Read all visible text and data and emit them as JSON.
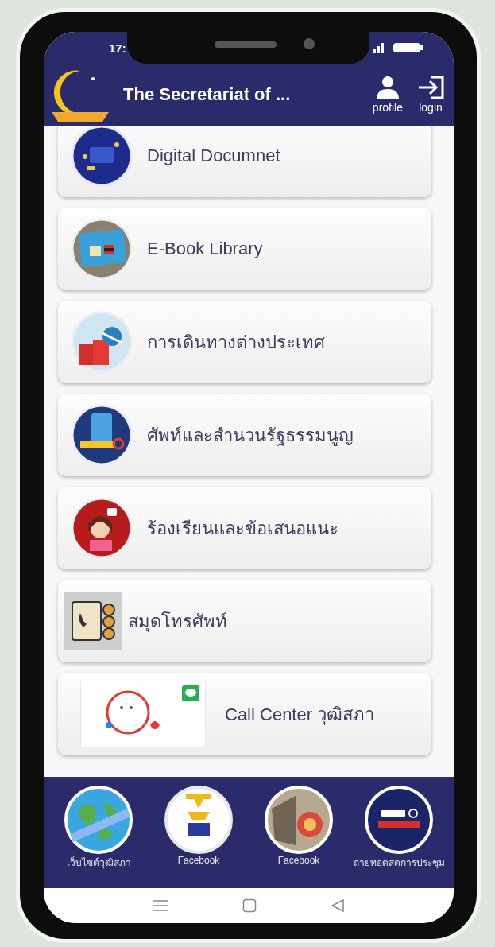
{
  "status_bar": {
    "time": "17:"
  },
  "header": {
    "title": "The Secretariat of ...",
    "actions": [
      {
        "label": "profile",
        "kind": "profile"
      },
      {
        "label": "login",
        "kind": "login"
      }
    ]
  },
  "menu": [
    {
      "label": "Digital Documnet",
      "kind": "document"
    },
    {
      "label": "E-Book Library",
      "kind": "ebook"
    },
    {
      "label": "การเดินทางต่างประเทศ",
      "kind": "travel"
    },
    {
      "label": "ศัพท์และสำนวนรัฐธรรมนูญ",
      "kind": "dictionary"
    },
    {
      "label": "ร้องเรียนและข้อเสนอแนะ",
      "kind": "petition"
    },
    {
      "label": "สมุดโทรศัพท์",
      "kind": "phonebook"
    },
    {
      "label": "Call Center วุฒิสภา",
      "kind": "callcenter"
    }
  ],
  "bottom_nav": [
    {
      "label": "เว็บไซต์วุฒิสภา",
      "kind": "globe"
    },
    {
      "label": "Facebook",
      "kind": "emblem"
    },
    {
      "label": "Facebook",
      "kind": "building"
    },
    {
      "label": "ถ่ายทอดสดการประชุม",
      "kind": "live"
    }
  ]
}
